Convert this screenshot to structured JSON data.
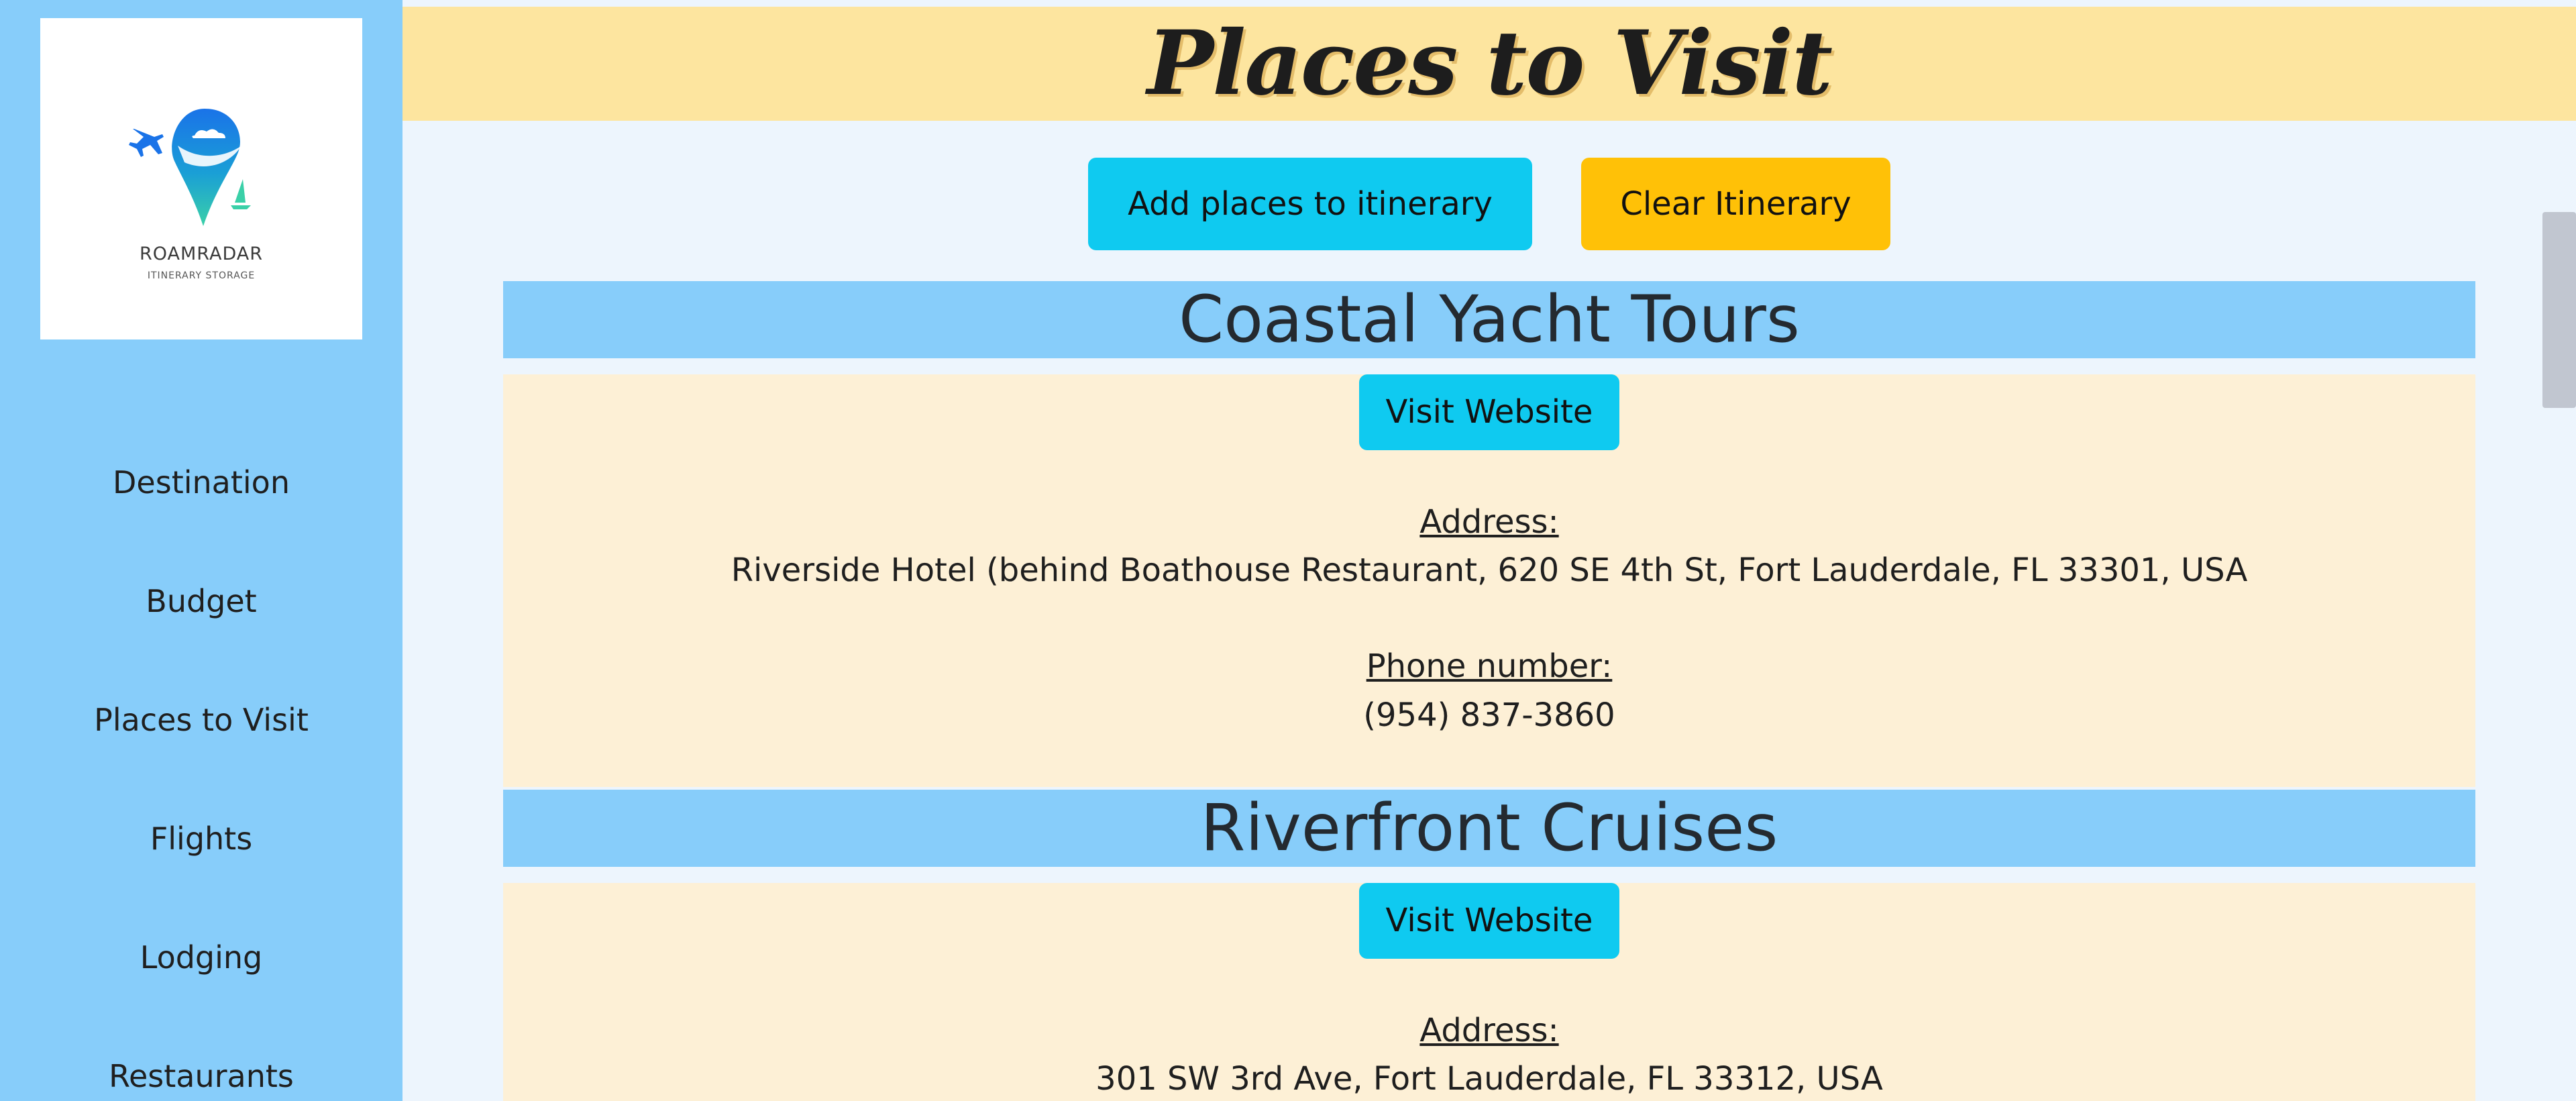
{
  "sidebar": {
    "logo": {
      "name": "ROAMRADAR",
      "tagline": "ITINERARY STORAGE"
    },
    "nav": [
      {
        "label": "Destination"
      },
      {
        "label": "Budget"
      },
      {
        "label": "Places to Visit"
      },
      {
        "label": "Flights"
      },
      {
        "label": "Lodging"
      },
      {
        "label": "Restaurants"
      }
    ]
  },
  "header": {
    "title": "Places to Visit"
  },
  "actions": {
    "add_label": "Add places to itinerary",
    "clear_label": "Clear Itinerary"
  },
  "places": [
    {
      "name": "Coastal Yacht Tours",
      "visit_label": "Visit Website",
      "address_label": "Address:",
      "address": "Riverside Hotel (behind Boathouse Restaurant, 620 SE 4th St, Fort Lauderdale, FL 33301, USA",
      "phone_label": "Phone number:",
      "phone": "(954) 837-3860"
    },
    {
      "name": "Riverfront Cruises",
      "visit_label": "Visit Website",
      "address_label": "Address:",
      "address": "301 SW 3rd Ave, Fort Lauderdale, FL 33312, USA"
    }
  ],
  "colors": {
    "sidebar": "#87cdfa",
    "header": "#fde59f",
    "primary_button": "#0fcaf0",
    "warning_button": "#ffc107",
    "card_body": "#fdf0d6",
    "page_bg": "#edf5fd"
  }
}
